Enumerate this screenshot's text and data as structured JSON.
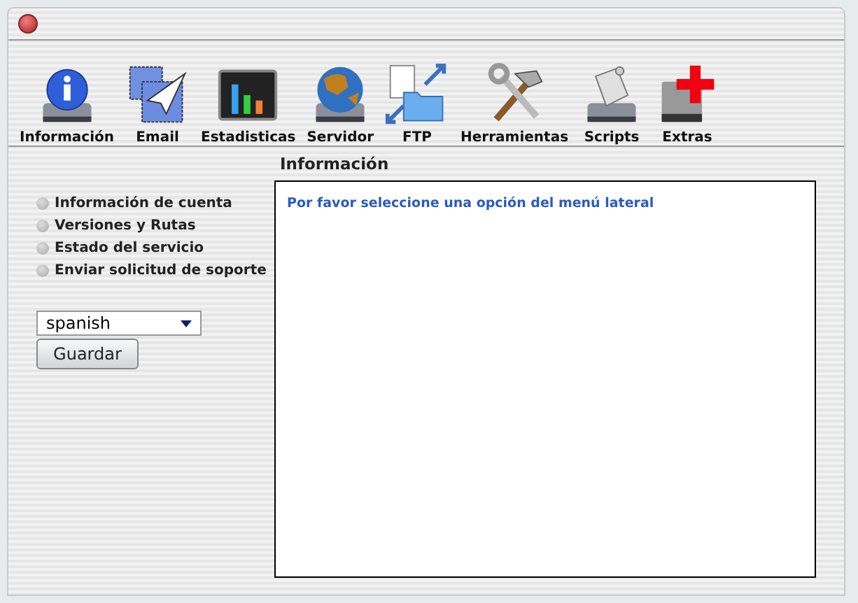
{
  "toolbar": [
    {
      "label": "Información",
      "kind": "info"
    },
    {
      "label": "Email",
      "kind": "email"
    },
    {
      "label": "Estadisticas",
      "kind": "stats"
    },
    {
      "label": "Servidor",
      "kind": "globe"
    },
    {
      "label": "FTP",
      "kind": "ftp"
    },
    {
      "label": "Herramientas",
      "kind": "tools"
    },
    {
      "label": "Scripts",
      "kind": "scripts"
    },
    {
      "label": "Extras",
      "kind": "extras"
    }
  ],
  "sidebar": {
    "items": [
      "Información de cuenta",
      "Versiones y Rutas",
      "Estado del servicio",
      "Enviar solicitud de soporte"
    ],
    "language_select": {
      "value": "spanish"
    },
    "save_button": "Guardar"
  },
  "panel": {
    "title": "Información",
    "message": "Por favor seleccione una opción del menú lateral"
  }
}
